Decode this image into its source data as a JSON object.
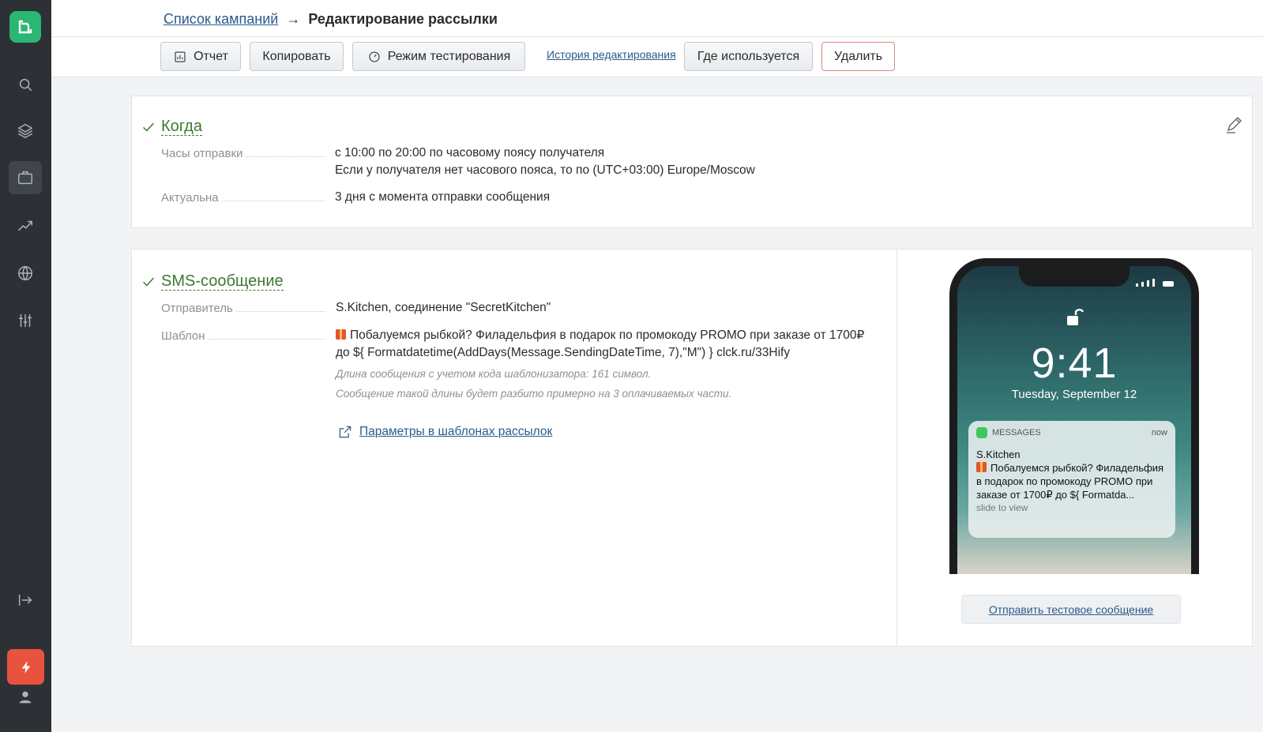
{
  "breadcrumb": {
    "parent": "Список кампаний",
    "arrow": "→",
    "current": "Редактирование рассылки"
  },
  "toolbar": {
    "report": "Отчет",
    "copy": "Копировать",
    "test_mode": "Режим тестирования",
    "history": "История редактирования",
    "where_used": "Где используется",
    "delete": "Удалить"
  },
  "when": {
    "title": "Когда",
    "rows": [
      {
        "label": "Часы отправки",
        "value1": "с 10:00 по 20:00 по часовому поясу получателя",
        "value2": "Если у получателя нет часового пояса, то по (UTC+03:00) Europe/Moscow"
      },
      {
        "label": "Актуальна",
        "value1": "3 дня с момента отправки сообщения"
      }
    ]
  },
  "sms": {
    "title": "SMS-сообщение",
    "sender_label": "Отправитель",
    "sender_value": "S.Kitchen, соединение \"SecretKitchen\"",
    "template_label": "Шаблон",
    "template_line1": "Побалуемся рыбкой? Филадельфия в подарок по промокоду PROMO при заказе от 1700₽",
    "template_line2": "до ${ Formatdatetime(AddDays(Message.SendingDateTime, 7),\"M\") } clck.ru/33Hify",
    "note1": "Длина сообщения с учетом кода шаблонизатора: 161 символ.",
    "note2": "Сообщение такой длины будет разбито примерно на 3 оплачиваемых части.",
    "params_link": "Параметры в шаблонах рассылок"
  },
  "phone": {
    "time": "9:41",
    "date": "Tuesday, September 12",
    "app": "MESSAGES",
    "now": "now",
    "sender": "S.Kitchen",
    "body": "Побалуемся рыбкой? Филадельфия в подарок по промокоду PROMO при заказе от 1700₽ до ${ Formatda...",
    "slide": "slide to view"
  },
  "send_test": "Отправить тестовое сообщение",
  "colors": {
    "accent_green": "#2bb673",
    "title_green": "#3c7a2e",
    "danger": "#e8533f",
    "sidebar": "#2d3135",
    "link": "#2a5b8a"
  },
  "icons": [
    "logo-icon",
    "search-icon",
    "layers-icon",
    "briefcase-icon",
    "trend-icon",
    "globe-icon",
    "sliders-icon",
    "logout-icon",
    "bolt-icon",
    "user-icon",
    "chart-icon",
    "gauge-icon",
    "edit-icon",
    "external-link-icon",
    "check-icon"
  ]
}
